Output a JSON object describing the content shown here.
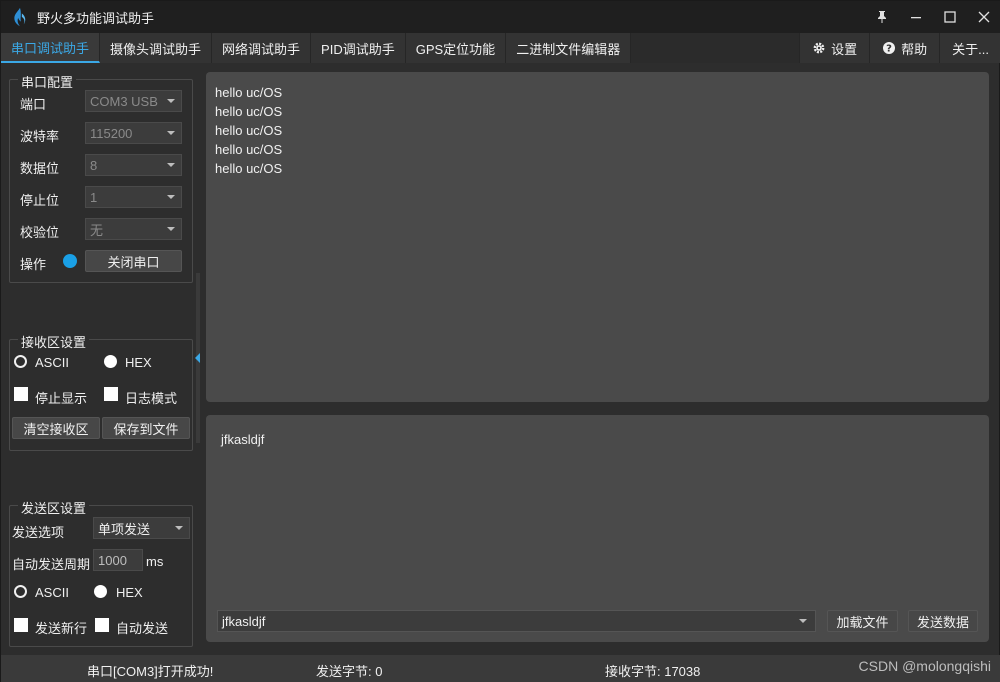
{
  "window": {
    "title": "野火多功能调试助手"
  },
  "tabs": [
    {
      "label": "串口调试助手",
      "active": true
    },
    {
      "label": "摄像头调试助手"
    },
    {
      "label": "网络调试助手"
    },
    {
      "label": "PID调试助手"
    },
    {
      "label": "GPS定位功能"
    },
    {
      "label": "二进制文件编辑器"
    }
  ],
  "tab_right": {
    "settings": "设置",
    "help": "帮助",
    "about": "关于..."
  },
  "serial_config": {
    "title": "串口配置",
    "port_label": "端口",
    "port_value": "COM3 USB",
    "baud_label": "波特率",
    "baud_value": "115200",
    "databits_label": "数据位",
    "databits_value": "8",
    "stopbits_label": "停止位",
    "stopbits_value": "1",
    "parity_label": "校验位",
    "parity_value": "无",
    "op_label": "操作",
    "close_button": "关闭串口"
  },
  "recv_settings": {
    "title": "接收区设置",
    "ascii": "ASCII",
    "hex": "HEX",
    "stop_display": "停止显示",
    "log_mode": "日志模式",
    "clear_button": "清空接收区",
    "save_button": "保存到文件"
  },
  "send_settings": {
    "title": "发送区设置",
    "option_label": "发送选项",
    "option_value": "单项发送",
    "period_label": "自动发送周期",
    "period_value": "1000",
    "period_unit": "ms",
    "ascii": "ASCII",
    "hex": "HEX",
    "newline": "发送新行",
    "auto_send": "自动发送"
  },
  "receive_lines": [
    "hello uc/OS",
    "hello uc/OS",
    "hello uc/OS",
    "hello uc/OS",
    "hello uc/OS"
  ],
  "send_area": {
    "text": "jfkasldjf",
    "history_value": "jfkasldjf",
    "load_file_button": "加载文件",
    "send_button": "发送数据"
  },
  "status": {
    "message": "串口[COM3]打开成功!",
    "sent_bytes": "发送字节: 0",
    "recv_bytes": "接收字节: 17038",
    "watermark": "CSDN @molongqishi"
  },
  "colors": {
    "accent": "#3ba8e6",
    "led": "#1aa0e6"
  }
}
